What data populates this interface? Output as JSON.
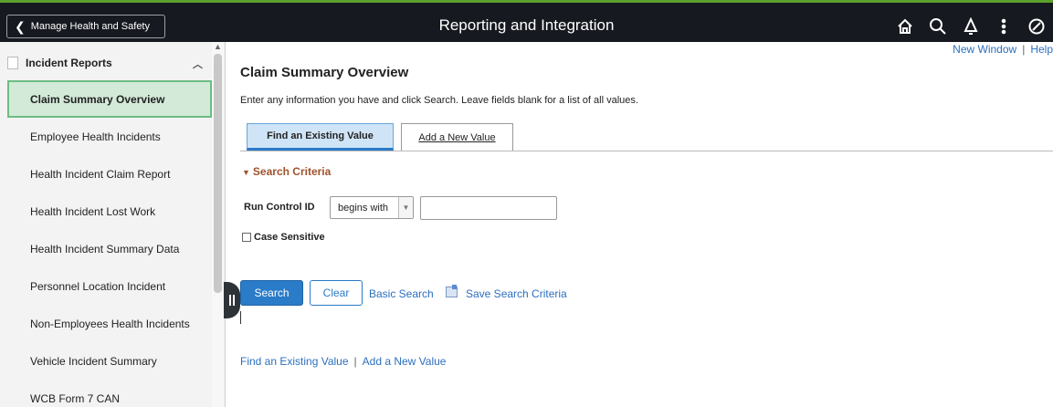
{
  "header": {
    "back_label": "Manage Health and Safety",
    "title": "Reporting and Integration",
    "icons": [
      "home-icon",
      "search-icon",
      "notification-bell-icon",
      "actions-menu-icon",
      "navbar-icon"
    ]
  },
  "sidebar": {
    "section_title": "Incident Reports",
    "items": [
      {
        "label": "Claim Summary Overview",
        "active": true
      },
      {
        "label": "Employee Health Incidents"
      },
      {
        "label": "Health Incident Claim Report"
      },
      {
        "label": "Health Incident Lost Work"
      },
      {
        "label": "Health Incident Summary Data"
      },
      {
        "label": "Personnel Location Incident"
      },
      {
        "label": "Non-Employees Health Incidents"
      },
      {
        "label": "Vehicle Incident Summary"
      },
      {
        "label": "WCB Form 7 CAN"
      }
    ]
  },
  "main": {
    "new_window": "New Window",
    "help": "Help",
    "page_title": "Claim Summary Overview",
    "instructions": "Enter any information you have and click Search. Leave fields blank for a list of all values.",
    "tabs": {
      "find": "Find an Existing Value",
      "add": "Add a New Value"
    },
    "criteria_title": "Search Criteria",
    "run_control_label": "Run Control ID",
    "operator": "begins with",
    "run_control_value": "",
    "case_sensitive": "Case Sensitive",
    "search_btn": "Search",
    "clear_btn": "Clear",
    "basic_search": "Basic Search",
    "save_search": "Save Search Criteria",
    "bottom_find": "Find an Existing Value",
    "bottom_add": "Add a New Value"
  },
  "colors": {
    "accent": "#2a7bc8",
    "topbar": "#16191f",
    "active_item": "#d3ead8",
    "criteria_heading": "#a0522d"
  }
}
